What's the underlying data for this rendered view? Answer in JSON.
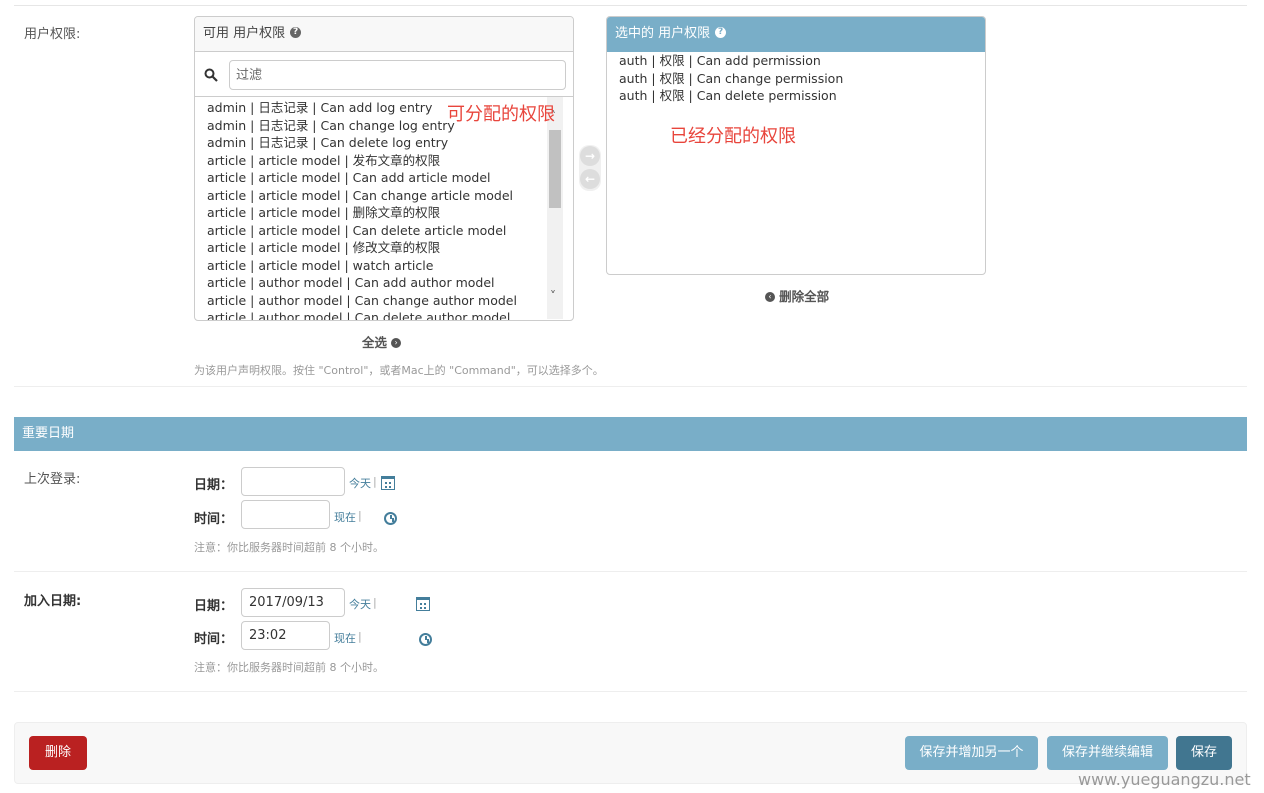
{
  "permissions": {
    "field_label": "用户权限:",
    "available_title": "可用 用户权限",
    "chosen_title": "选中的 用户权限",
    "filter_placeholder": "过滤",
    "available_items": [
      "admin | 日志记录 | Can add log entry",
      "admin | 日志记录 | Can change log entry",
      "admin | 日志记录 | Can delete log entry",
      "article | article model | 发布文章的权限",
      "article | article model | Can add article model",
      "article | article model | Can change article model",
      "article | article model | 删除文章的权限",
      "article | article model | Can delete article model",
      "article | article model | 修改文章的权限",
      "article | article model | watch article",
      "article | author model | Can add author model",
      "article | author model | Can change author model",
      "article | author model | Can delete author model"
    ],
    "chosen_items": [
      "auth | 权限 | Can add permission",
      "auth | 权限 | Can change permission",
      "auth | 权限 | Can delete permission"
    ],
    "choose_all": "全选",
    "remove_all": "删除全部",
    "help": "为该用户声明权限。按住 \"Control\"，或者Mac上的 \"Command\"，可以选择多个。",
    "annotation_available": "可分配的权限",
    "annotation_chosen": "已经分配的权限"
  },
  "dates_section": {
    "title": "重要日期",
    "last_login": {
      "label": "上次登录:",
      "date_label": "日期：",
      "date_value": "",
      "today_link": "今天",
      "time_label": "时间：",
      "time_value": "",
      "now_link": "现在",
      "note": "注意：你比服务器时间超前 8 个小时。"
    },
    "date_joined": {
      "label": "加入日期:",
      "date_label": "日期：",
      "date_value": "2017/09/13",
      "today_link": "今天",
      "time_label": "时间：",
      "time_value": "23:02",
      "now_link": "现在",
      "note": "注意：你比服务器时间超前 8 个小时。"
    }
  },
  "submit": {
    "delete": "删除",
    "save_add_another": "保存并增加另一个",
    "save_continue": "保存并继续编辑",
    "save": "保存"
  },
  "watermark": "www.yueguangzu.net",
  "colors": {
    "header_blue": "#79aec8",
    "primary": "#417690",
    "delete_red": "#ba2121",
    "link": "#447e9b",
    "annotation_red": "#e8453c"
  },
  "icons": [
    "search-icon",
    "help-icon",
    "arrow-right-icon",
    "arrow-left-icon",
    "calendar-icon",
    "clock-icon",
    "chevron-up-icon",
    "chevron-down-icon"
  ]
}
